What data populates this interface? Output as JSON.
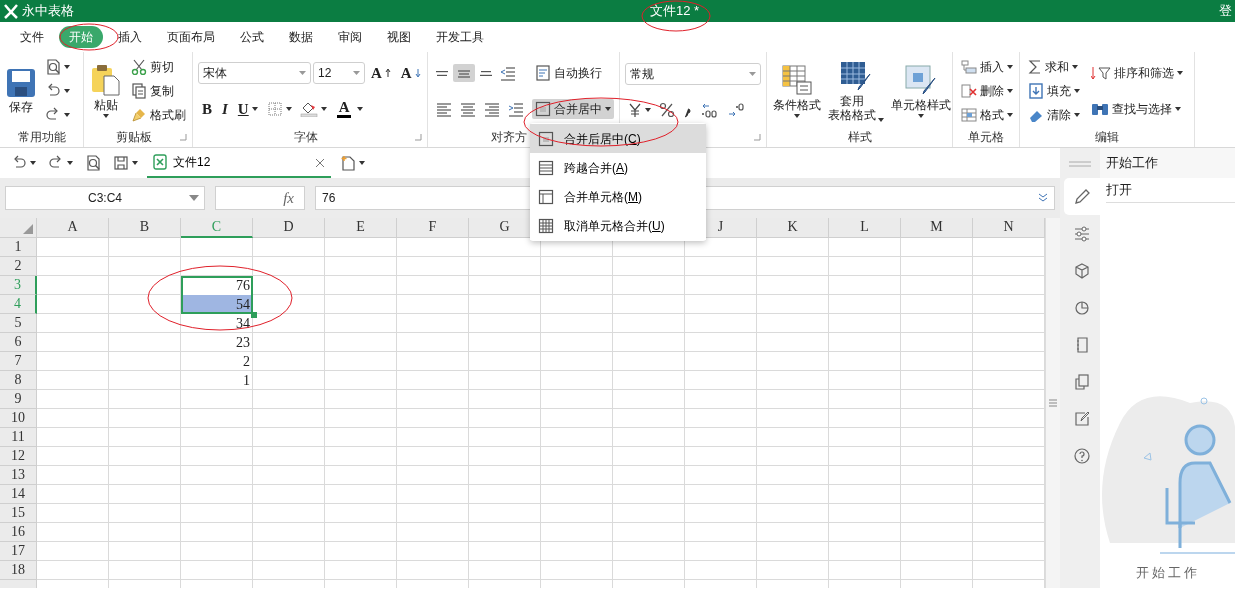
{
  "title_bar": {
    "app_name": "永中表格",
    "document_title": "文件12 *",
    "login": "登"
  },
  "menu_tabs": [
    {
      "label": "文件",
      "selected": false
    },
    {
      "label": "开始",
      "selected": true
    },
    {
      "label": "插入",
      "selected": false
    },
    {
      "label": "页面布局",
      "selected": false
    },
    {
      "label": "公式",
      "selected": false
    },
    {
      "label": "数据",
      "selected": false
    },
    {
      "label": "审阅",
      "selected": false
    },
    {
      "label": "视图",
      "selected": false
    },
    {
      "label": "开发工具",
      "selected": false
    }
  ],
  "ribbon": [
    {
      "label": "常用功能",
      "columns": [
        [
          [
            {
              "kind": "large",
              "label": "保存"
            }
          ]
        ],
        [
          [
            {
              "kind": "icon",
              "caret": true
            }
          ],
          [
            {
              "kind": "icon",
              "caret": true
            }
          ],
          [
            {
              "kind": "icon",
              "caret": true
            }
          ]
        ]
      ]
    },
    {
      "label": "剪贴板",
      "launcher": true,
      "columns": [
        [
          [
            {
              "kind": "large",
              "label": "粘贴",
              "caret": true
            }
          ]
        ],
        [
          [
            {
              "kind": "small",
              "label": "剪切"
            }
          ],
          [
            {
              "kind": "small",
              "label": "复制"
            }
          ],
          [
            {
              "kind": "small",
              "label": "格式刷"
            }
          ]
        ]
      ]
    },
    {
      "label": "字体",
      "launcher": true,
      "columns": [
        [
          [
            {
              "kind": "select",
              "value": "宋体"
            },
            {
              "kind": "select",
              "value": "12"
            },
            {
              "kind": "glyph",
              "label": "A"
            },
            {
              "kind": "glyph",
              "label": "A"
            }
          ],
          [
            {
              "kind": "glyph",
              "label": "B"
            },
            {
              "kind": "glyph",
              "label": "I"
            },
            {
              "kind": "glyph",
              "label": "U",
              "caret": true
            },
            {
              "kind": "icon",
              "caret": true
            },
            {
              "kind": "icon",
              "caret": true
            },
            {
              "kind": "glyph",
              "label": "A",
              "caret": true
            }
          ]
        ]
      ]
    },
    {
      "label": "对齐方",
      "columns": [
        [
          [
            {
              "kind": "toggle",
              "selected": false
            },
            {
              "kind": "toggle",
              "selected": true
            },
            {
              "kind": "toggle",
              "selected": false
            },
            {
              "kind": "icon"
            }
          ],
          [
            {
              "kind": "toggle",
              "selected": false
            },
            {
              "kind": "toggle",
              "selected": false
            },
            {
              "kind": "toggle",
              "selected": false
            },
            {
              "kind": "icon"
            }
          ]
        ],
        [
          [
            {
              "kind": "small",
              "label": "自动换行"
            }
          ],
          [
            {
              "kind": "small",
              "label": "合并居中",
              "caret": true,
              "expanded": true
            }
          ]
        ]
      ]
    },
    {
      "launcher": true,
      "columns": [
        [
          [
            {
              "kind": "select",
              "value": "常规"
            }
          ],
          [
            {
              "kind": "icon",
              "caret": true
            },
            {
              "kind": "icon"
            },
            {
              "kind": "icon"
            },
            {
              "kind": "icon"
            },
            {
              "kind": "icon"
            }
          ]
        ]
      ]
    },
    {
      "label": "样式",
      "columns": [
        [
          [
            {
              "kind": "large",
              "label": "条件格式",
              "caret": true
            }
          ]
        ],
        [
          [
            {
              "kind": "large",
              "label_lines": [
                "套用",
                "表格格式"
              ],
              "caret": true
            }
          ]
        ],
        [
          [
            {
              "kind": "large",
              "label": "单元格样式",
              "caret": true
            }
          ]
        ]
      ]
    },
    {
      "label": "单元格",
      "columns": [
        [
          [
            {
              "kind": "small",
              "label": "插入",
              "caret": true
            }
          ],
          [
            {
              "kind": "small",
              "label": "删除",
              "caret": true
            }
          ],
          [
            {
              "kind": "small",
              "label": "格式",
              "caret": true
            }
          ]
        ]
      ]
    },
    {
      "label": "编辑",
      "columns": [
        [
          [
            {
              "kind": "small",
              "label": "求和",
              "caret": true
            }
          ],
          [
            {
              "kind": "small",
              "label": "填充",
              "caret": true
            }
          ],
          [
            {
              "kind": "small",
              "label": "清除",
              "caret": true
            }
          ]
        ],
        [
          [
            {
              "kind": "small",
              "label": "排序和筛选",
              "caret": true
            }
          ],
          [
            {
              "kind": "small",
              "label": "查找与选择",
              "caret": true
            }
          ]
        ]
      ]
    }
  ],
  "quick_access": [
    {
      "caret": true
    },
    {
      "caret": true
    },
    {
      "caret": false
    },
    {
      "caret": true
    }
  ],
  "document_tabs": [
    {
      "label": "文件12",
      "selected": true
    }
  ],
  "formula_bar": {
    "name_box": "C3:C4",
    "function_label": "fx",
    "value": "76"
  },
  "merge_menu": [
    {
      "before": "合并后居中(",
      "key": "C",
      "after": ")",
      "selected": true
    },
    {
      "before": "跨越合并(",
      "key": "A",
      "after": ")",
      "selected": false
    },
    {
      "before": "合并单元格(",
      "key": "M",
      "after": ")",
      "selected": false
    },
    {
      "before": "取消单元格合并(",
      "key": "U",
      "after": ")",
      "selected": false
    }
  ],
  "sheet": {
    "columns": [
      {
        "label": "A",
        "selected": false
      },
      {
        "label": "B",
        "selected": false
      },
      {
        "label": "C",
        "selected": true
      },
      {
        "label": "D",
        "selected": false
      },
      {
        "label": "E",
        "selected": false
      },
      {
        "label": "F",
        "selected": false
      },
      {
        "label": "G",
        "selected": false
      },
      {},
      {},
      {
        "label": "J",
        "selected": false
      },
      {
        "label": "K",
        "selected": false
      },
      {
        "label": "L",
        "selected": false
      },
      {
        "label": "M",
        "selected": false
      },
      {
        "label": "N",
        "selected": false
      }
    ],
    "rows": [
      {
        "label": "1",
        "selected": false
      },
      {
        "label": "2",
        "selected": false
      },
      {
        "label": "3",
        "selected": true,
        "cells": [
          null,
          null,
          {
            "value": "76",
            "selected": true,
            "active": true
          }
        ]
      },
      {
        "label": "4",
        "selected": true,
        "cells": [
          null,
          null,
          {
            "value": "54",
            "selected": true,
            "active": false
          }
        ]
      },
      {
        "label": "5",
        "selected": false,
        "cells": [
          null,
          null,
          {
            "value": "34",
            "selected": false
          }
        ]
      },
      {
        "label": "6",
        "selected": false,
        "cells": [
          null,
          null,
          {
            "value": "23",
            "selected": false
          }
        ]
      },
      {
        "label": "7",
        "selected": false,
        "cells": [
          null,
          null,
          {
            "value": "2",
            "selected": false
          }
        ]
      },
      {
        "label": "8",
        "selected": false,
        "cells": [
          null,
          null,
          {
            "value": "1",
            "selected": false
          }
        ]
      },
      {
        "label": "9",
        "selected": false
      },
      {
        "label": "10",
        "selected": false
      },
      {
        "label": "11",
        "selected": false
      },
      {
        "label": "12",
        "selected": false
      },
      {
        "label": "13",
        "selected": false
      },
      {
        "label": "14",
        "selected": false
      },
      {
        "label": "15",
        "selected": false
      },
      {
        "label": "16",
        "selected": false
      },
      {
        "label": "17",
        "selected": false
      },
      {
        "label": "18",
        "selected": false
      }
    ]
  },
  "task_pane": {
    "title": "开始工作",
    "item": "打开",
    "rail": [
      {
        "selected": true
      },
      {
        "selected": false
      },
      {
        "selected": false
      },
      {
        "selected": false
      },
      {
        "selected": false
      },
      {
        "selected": false
      },
      {
        "selected": false
      },
      {
        "selected": false
      }
    ],
    "caption": "开始工作"
  }
}
